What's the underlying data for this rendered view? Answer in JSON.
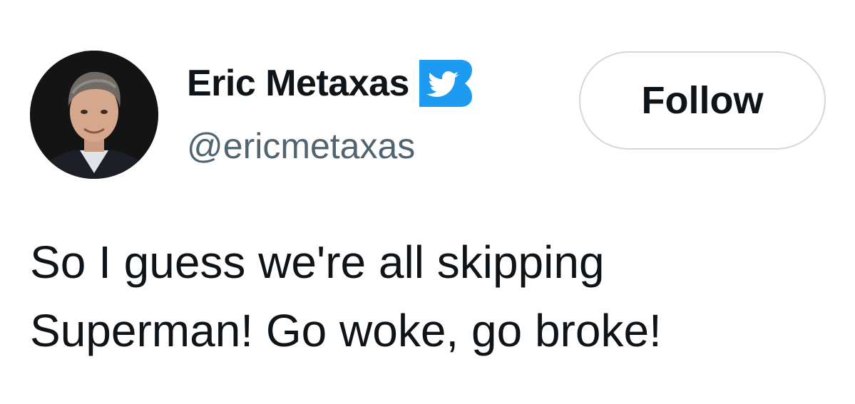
{
  "author": {
    "display_name": "Eric Metaxas",
    "handle": "@ericmetaxas",
    "avatar_icon": "profile-photo",
    "badge_icon": "twitter-bird-badge-icon"
  },
  "actions": {
    "follow_label": "Follow"
  },
  "tweet": {
    "lines": [
      "So I guess we're all skipping",
      "Superman! Go woke, go broke!"
    ]
  },
  "colors": {
    "text_primary": "#0f1419",
    "text_secondary": "#536471",
    "badge_blue": "#1d9bf0",
    "button_border": "#cfd9de"
  }
}
